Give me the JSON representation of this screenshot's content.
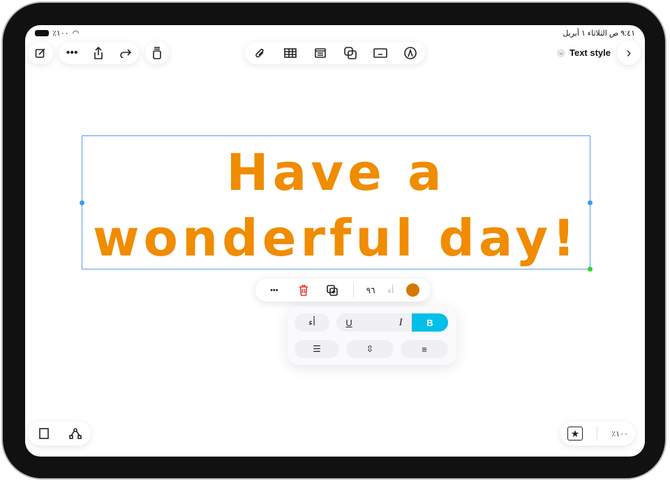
{
  "status": {
    "battery": "٪١٠٠",
    "datetime": "٩:٤١ ص  الثلاثاء ١ أبريل"
  },
  "toolbar": {
    "text_style": "Text style"
  },
  "canvas": {
    "line1": "Have a",
    "line2": "wonderful day!",
    "text_color": "#f08c00"
  },
  "context_menu": {
    "font_size": "٩٦",
    "font_sample": "أء",
    "color": "#d67800"
  },
  "format_panel": {
    "font_sample": "أء",
    "underline": "U",
    "italic": "I",
    "bold": "B",
    "bold_active": true,
    "accent": "#00bfe8"
  },
  "bottom": {
    "zoom": "٪١٠٠"
  }
}
